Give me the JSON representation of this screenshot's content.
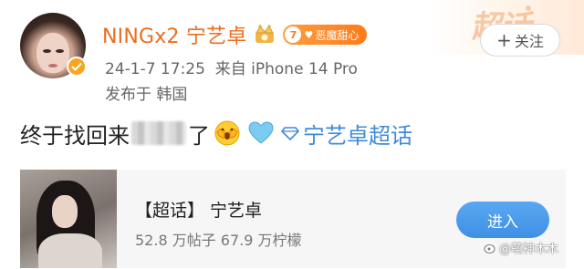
{
  "header": {
    "username": "NINGx2 宁艺卓",
    "fan_badge": {
      "level": "7",
      "label": "恶魔甜心"
    },
    "follow_label": "关注",
    "timestamp": "24-1-7 17:25",
    "source": "来自 iPhone 14 Pro",
    "location": "发布于 韩国",
    "watermark_label": "超话"
  },
  "post": {
    "text_before": "终于找回来",
    "text_after": "了",
    "topic_link": "宁艺卓超话"
  },
  "card": {
    "title": "【超话】 宁艺卓",
    "stats": "52.8 万帖子  67.9 万柠檬",
    "enter_label": "进入"
  },
  "footer": {
    "watermark": "@萌神木木"
  },
  "colors": {
    "username": "#ec6d20",
    "link": "#3f8bd9",
    "badge": "#ff7a18",
    "enter_button": "#3f8fe4"
  },
  "icons": [
    "verified-badge-icon",
    "crown-icon",
    "heart-icon",
    "plus-icon",
    "face-emoji-icon",
    "blue-heart-icon",
    "diamond-icon",
    "weibo-watermark-icon"
  ]
}
